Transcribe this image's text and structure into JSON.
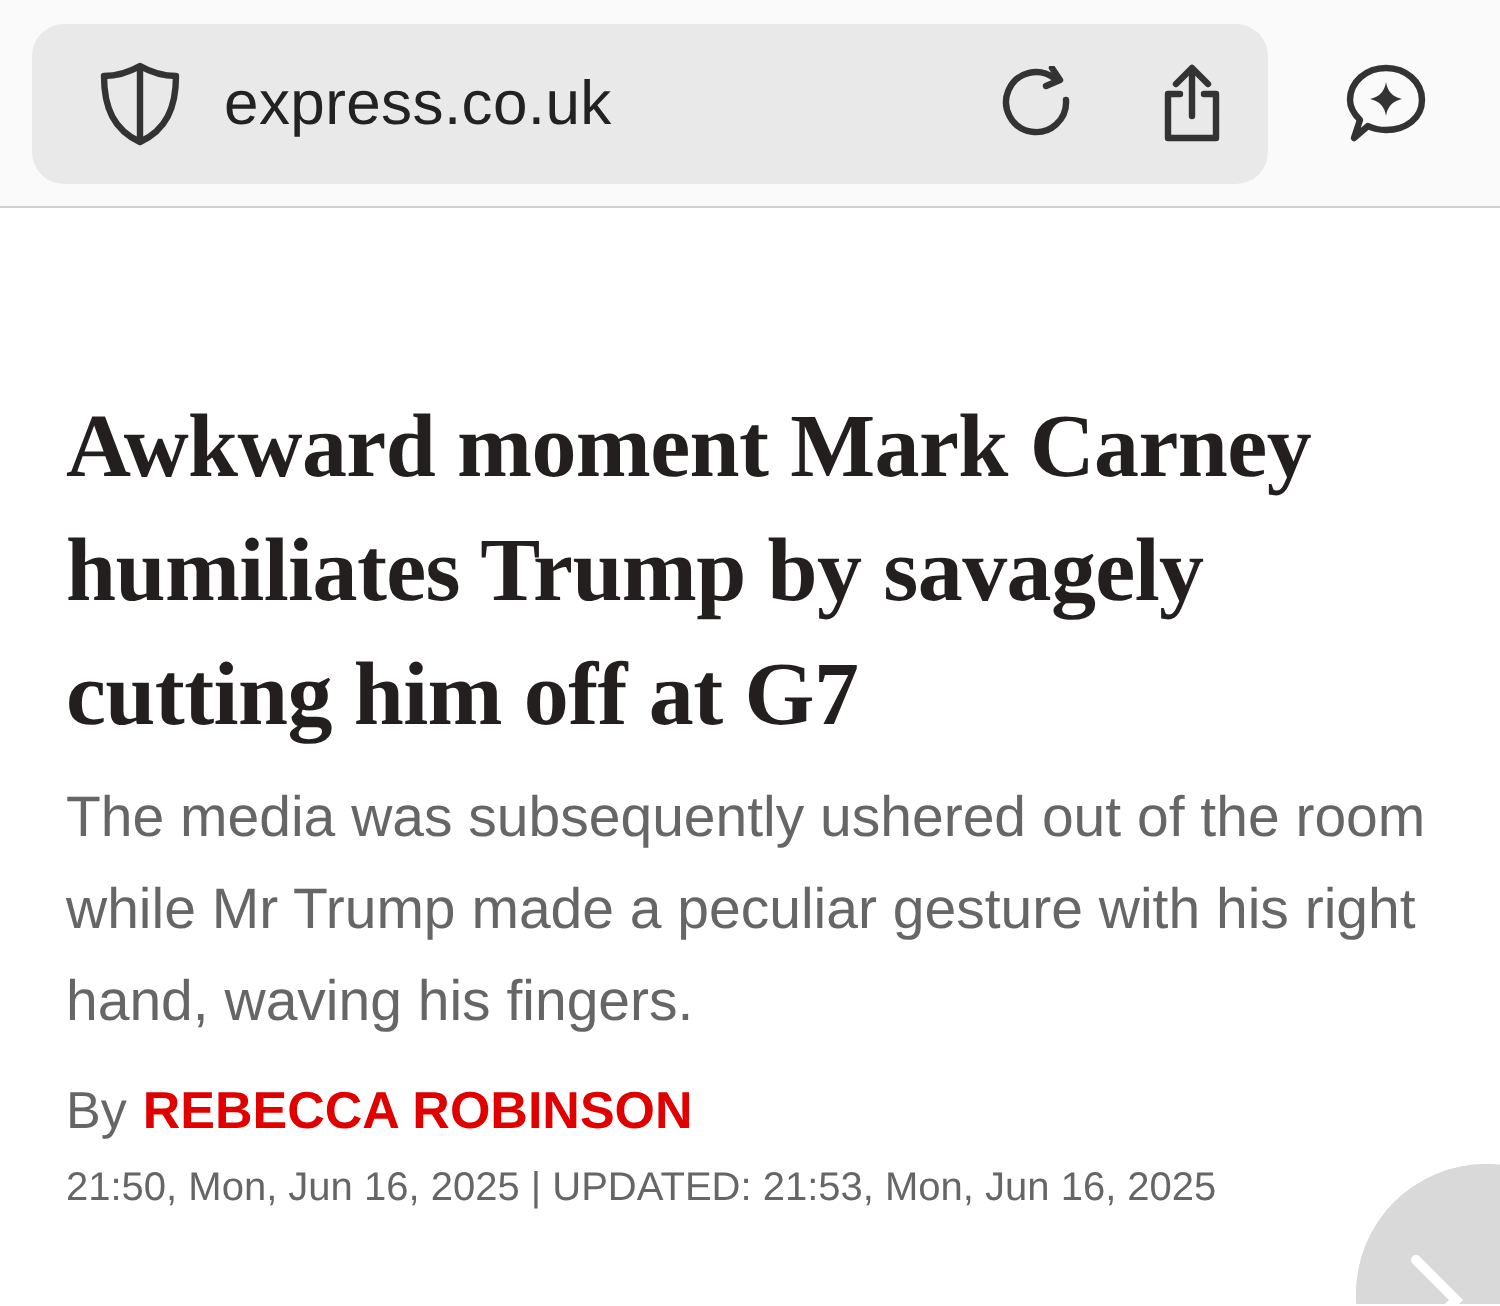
{
  "address_bar": {
    "url": "express.co.uk"
  },
  "article": {
    "headline": "Awkward moment Mark Carney humiliates Trump by savagely cutting him off at G7",
    "standfirst": "The media was subsequently ushered out of the room while Mr Trump made a peculiar gesture with his right hand, waving his fingers.",
    "byline_prefix": "By",
    "author": "REBECCA ROBINSON",
    "timestamp": "21:50, Mon, Jun 16, 2025 | UPDATED: 21:53, Mon, Jun 16, 2025"
  }
}
